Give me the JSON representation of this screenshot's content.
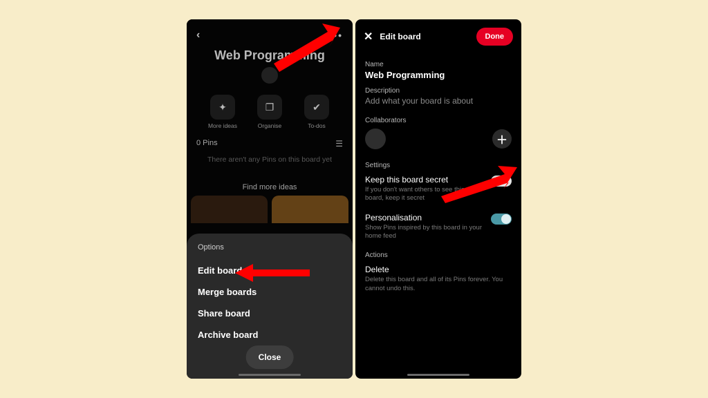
{
  "left": {
    "board_title": "Web Programming",
    "actions": {
      "more_ideas": "More ideas",
      "organise": "Organise",
      "todos": "To-dos"
    },
    "pins_count": "0 Pins",
    "empty_text": "There aren't any Pins on this board yet",
    "find_more": "Find more ideas",
    "sheet": {
      "heading": "Options",
      "edit": "Edit board",
      "merge": "Merge boards",
      "share": "Share board",
      "archive": "Archive board",
      "close": "Close"
    }
  },
  "right": {
    "header_title": "Edit board",
    "done": "Done",
    "name_label": "Name",
    "name_value": "Web Programming",
    "desc_label": "Description",
    "desc_placeholder": "Add what your board is about",
    "collab_label": "Collaborators",
    "settings_label": "Settings",
    "secret_title": "Keep this board secret",
    "secret_help": "If you don't want others to see this board, keep it secret",
    "pers_title": "Personalisation",
    "pers_help": "Show Pins inspired by this board in your home feed",
    "actions_label": "Actions",
    "delete_title": "Delete",
    "delete_help": "Delete this board and all of its Pins forever. You cannot undo this."
  }
}
